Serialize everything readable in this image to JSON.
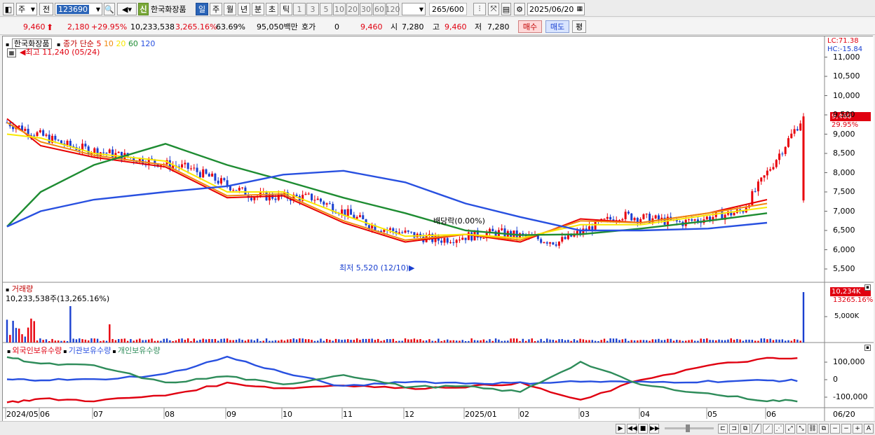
{
  "toolbar": {
    "period_select": "주",
    "prev_label": "전",
    "stock_code": "123690",
    "badge_new": "신",
    "stock_name": "한국화장품",
    "period_tabs": [
      "일",
      "주",
      "월",
      "년",
      "분",
      "초",
      "틱"
    ],
    "active_tab": "일",
    "intervals": [
      "1",
      "3",
      "5",
      "10",
      "20",
      "30",
      "60",
      "120"
    ],
    "count": "265",
    "count_total": "/600",
    "date": "2025/06/20"
  },
  "quote": {
    "price": "9,460",
    "change": "2,180",
    "change_pct": "+29.95%",
    "volume": "10,233,538",
    "vol_ratio": "3,265.16%",
    "turnover": "63.69%",
    "amount": "95,050백만",
    "hoga_label": "호가",
    "hoga_value": "0",
    "hoga_price": "9,460",
    "open_label": "시",
    "open": "7,280",
    "high_label": "고",
    "high": "9,460",
    "low_label": "저",
    "low": "7,280",
    "buy_label": "매수",
    "sell_label": "매도",
    "eval_label": "평"
  },
  "price_panel": {
    "legend_name": "한국화장품",
    "legend_ma_label": "종가 단순",
    "ma_periods": [
      "5",
      "10",
      "20",
      "60",
      "120"
    ],
    "max_annotation": "최고 11,240 (05/24)",
    "min_annotation": "최저 5,520 (12/10)",
    "dividend_annotation": "배당락(0.00%)",
    "lc_label": "LC:71.38",
    "hc_label": "HC:-15.84",
    "current_tag": "9,460",
    "current_pct": "29.95%",
    "y_ticks": [
      "11,000",
      "10,500",
      "10,000",
      "9,500",
      "9,000",
      "8,500",
      "8,000",
      "7,500",
      "7,000",
      "6,500",
      "6,000",
      "5,500"
    ]
  },
  "volume_panel": {
    "title": "거래량",
    "value_text": "10,233,538주(13,265.16%)",
    "current_tag": "10,234K",
    "current_pct": "13265.16%",
    "y_tick": "5,000K"
  },
  "holding_panel": {
    "series": [
      "외국인보유수량",
      "기관보유수량",
      "개인보유수량"
    ],
    "y_ticks": [
      "100,000",
      "0",
      "-100,000"
    ]
  },
  "x_axis": {
    "labels": [
      "2024/05",
      "06",
      "07",
      "08",
      "09",
      "10",
      "11",
      "12",
      "2025/01",
      "02",
      "03",
      "04",
      "05",
      "06"
    ],
    "end_date": "06/20"
  },
  "colors": {
    "up": "#e8000c",
    "down": "#1a40d0",
    "ma5": "#e80000",
    "ma10": "#f08a10",
    "ma20": "#f8e800",
    "ma60": "#1e8c32",
    "ma120": "#2850e0",
    "foreign": "#e00010",
    "institution": "#2850e0",
    "individual": "#2e8c5a"
  },
  "chart_data": {
    "type": "line",
    "title": "",
    "ylim": [
      5500,
      11000
    ],
    "x": [
      "2024/05",
      "06",
      "07",
      "08",
      "09",
      "10",
      "11",
      "12",
      "2025/01",
      "02",
      "03",
      "04",
      "05",
      "06"
    ],
    "series": [
      {
        "name": "종가",
        "values": [
          9300,
          8700,
          8400,
          8100,
          7400,
          7350,
          6600,
          6250,
          6450,
          6200,
          6900,
          6700,
          7000,
          9460
        ]
      },
      {
        "name": "5",
        "values": [
          9400,
          8700,
          8400,
          8150,
          7350,
          7400,
          6700,
          6200,
          6400,
          6200,
          6800,
          6700,
          6950,
          7300
        ]
      },
      {
        "name": "10",
        "values": [
          9300,
          8800,
          8450,
          8200,
          7400,
          7450,
          6750,
          6250,
          6400,
          6250,
          6750,
          6700,
          6950,
          7200
        ]
      },
      {
        "name": "20",
        "values": [
          9000,
          8900,
          8500,
          8300,
          7500,
          7500,
          6900,
          6350,
          6400,
          6300,
          6650,
          6650,
          6900,
          7100
        ]
      },
      {
        "name": "60",
        "values": [
          6600,
          7500,
          8200,
          8750,
          8200,
          7800,
          7350,
          6950,
          6500,
          6380,
          6400,
          6550,
          6750,
          6950
        ]
      },
      {
        "name": "120",
        "values": [
          6600,
          7000,
          7300,
          7500,
          7650,
          7950,
          8050,
          7750,
          7200,
          6850,
          6500,
          6500,
          6550,
          6700
        ]
      }
    ],
    "holding": {
      "ylim": [
        -150000,
        150000
      ],
      "series": [
        {
          "name": "외국인보유수량",
          "values": [
            -130000,
            -110000,
            -120000,
            -90000,
            -20000,
            -50000,
            -30000,
            -50000,
            -40000,
            -20000,
            -120000,
            0,
            80000,
            120000
          ]
        },
        {
          "name": "기관보유수량",
          "values": [
            0,
            0,
            0,
            30000,
            130000,
            40000,
            -40000,
            -10000,
            -20000,
            -20000,
            -10000,
            -15000,
            -10000,
            -5000
          ]
        },
        {
          "name": "개인보유수량",
          "values": [
            130000,
            90000,
            80000,
            -20000,
            20000,
            -30000,
            30000,
            -40000,
            -40000,
            -70000,
            100000,
            -30000,
            -80000,
            -120000
          ]
        }
      ]
    }
  }
}
